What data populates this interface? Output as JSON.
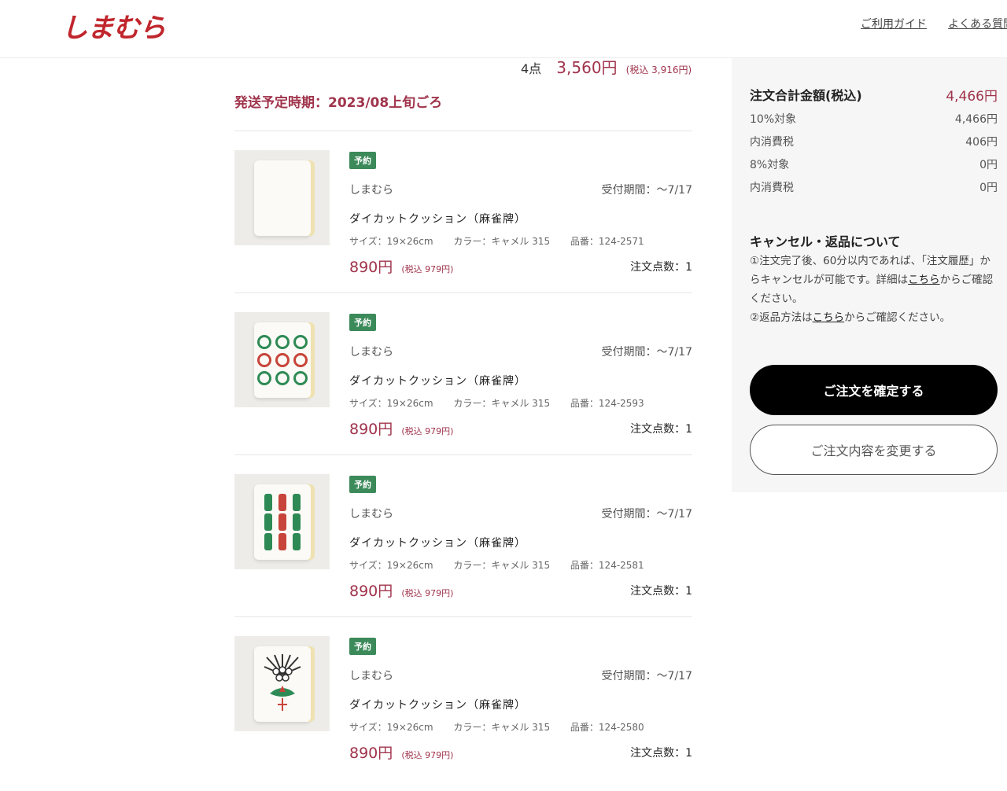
{
  "header": {
    "logo": "しまむら",
    "links": [
      "ご利用ガイド",
      "よくある質問"
    ]
  },
  "summary": {
    "qty": "4点",
    "price": "3,560円",
    "tax": "(税込 3,916円)"
  },
  "ship_date": "発送予定時期：2023/08上旬ごろ",
  "items": [
    {
      "badge": "予約",
      "brand": "しまむら",
      "period": "受付期間：～7/17",
      "name": "ダイカットクッション（麻雀牌）",
      "size": "サイズ：19×26cm",
      "color": "カラー：キャメル 315",
      "code": "品番：124-2571",
      "price": "890円",
      "tax": "(税込 979円)",
      "count": "注文点数：1"
    },
    {
      "badge": "予約",
      "brand": "しまむら",
      "period": "受付期間：～7/17",
      "name": "ダイカットクッション（麻雀牌）",
      "size": "サイズ：19×26cm",
      "color": "カラー：キャメル 315",
      "code": "品番：124-2593",
      "price": "890円",
      "tax": "(税込 979円)",
      "count": "注文点数：1"
    },
    {
      "badge": "予約",
      "brand": "しまむら",
      "period": "受付期間：～7/17",
      "name": "ダイカットクッション（麻雀牌）",
      "size": "サイズ：19×26cm",
      "color": "カラー：キャメル 315",
      "code": "品番：124-2581",
      "price": "890円",
      "tax": "(税込 979円)",
      "count": "注文点数：1"
    },
    {
      "badge": "予約",
      "brand": "しまむら",
      "period": "受付期間：～7/17",
      "name": "ダイカットクッション（麻雀牌）",
      "size": "サイズ：19×26cm",
      "color": "カラー：キャメル 315",
      "code": "品番：124-2580",
      "price": "890円",
      "tax": "(税込 979円)",
      "count": "注文点数：1"
    }
  ],
  "totals": {
    "total_label": "注文合計金額(税込)",
    "total_value": "4,466円",
    "r10_label": "10%対象",
    "r10_value": "4,466円",
    "tax10_label": "内消費税",
    "tax10_value": "406円",
    "r8_label": "8%対象",
    "r8_value": "0円",
    "tax8_label": "内消費税",
    "tax8_value": "0円"
  },
  "cancel": {
    "title": "キャンセル・返品について",
    "line1": "①注文完了後、60分以内であれば、「注文履歴」からキャンセルが可能です。詳細は",
    "link1": "こちら",
    "line1_end": "からご確認ください。",
    "line2": "②返品方法は",
    "link2": "こちら",
    "line2_end": "からご確認ください。"
  },
  "buttons": {
    "confirm": "ご注文を確定する",
    "change": "ご注文内容を変更する"
  },
  "colors": {
    "brand": "#c0262c",
    "price": "#a0344c",
    "badge": "#3c8a5a"
  }
}
